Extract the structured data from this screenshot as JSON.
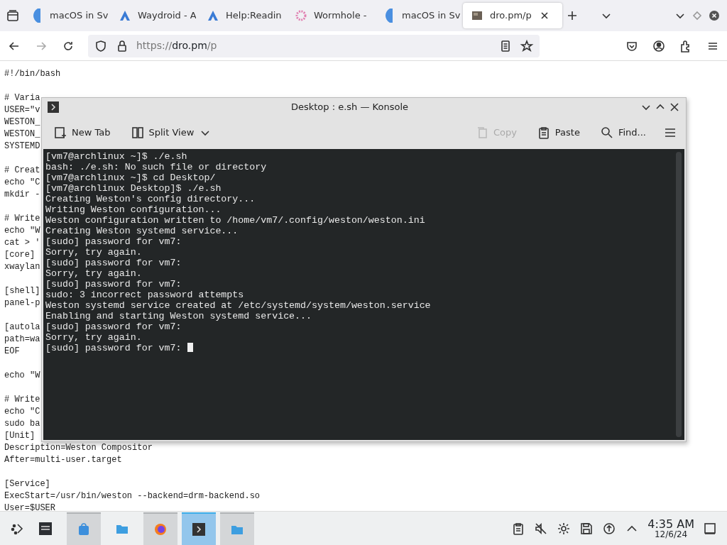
{
  "browser": {
    "tabs": [
      {
        "title": "macOS in Sv",
        "selected": false
      },
      {
        "title": "Waydroid - A",
        "selected": false
      },
      {
        "title": "Help:Readin",
        "selected": false
      },
      {
        "title": "Wormhole -",
        "selected": false
      },
      {
        "title": "macOS in Sv",
        "selected": false
      },
      {
        "title": "dro.pm/p",
        "selected": true
      }
    ],
    "url": {
      "scheme": "https://",
      "host": "dro.pm",
      "path": "/p"
    }
  },
  "page": {
    "blocks": [
      [
        "#!/bin/bash"
      ],
      [
        "# Varia",
        "USER=\"v",
        "WESTON_",
        "WESTON_",
        "SYSTEMD"
      ],
      [
        "# Creat",
        "echo \"C",
        "mkdir -"
      ],
      [
        "# Write",
        "echo \"W",
        "cat > '",
        "[core]",
        "xwaylan"
      ],
      [
        "[shell]",
        "panel-p"
      ],
      [
        "[autola",
        "path=wa",
        "EOF"
      ],
      [
        "echo \"W"
      ],
      [
        "# Write",
        "echo \"C",
        "sudo ba",
        "[Unit]",
        "Description=Weston Compositor",
        "After=multi-user.target"
      ],
      [
        "[Service]",
        "ExecStart=/usr/bin/weston --backend=drm-backend.so",
        "User=$USER"
      ]
    ]
  },
  "konsole": {
    "title": "Desktop : e.sh — Konsole",
    "toolbar": [
      {
        "label": "New Tab",
        "disabled": false
      },
      {
        "label": "Split View",
        "disabled": false
      },
      {
        "label": "Copy",
        "disabled": true
      },
      {
        "label": "Paste",
        "disabled": false
      },
      {
        "label": "Find...",
        "disabled": false
      }
    ],
    "lines": [
      "[vm7@archlinux ~]$ ./e.sh",
      "bash: ./e.sh: No such file or directory",
      "[vm7@archlinux ~]$ cd Desktop/",
      "[vm7@archlinux Desktop]$ ./e.sh",
      "Creating Weston's config directory...",
      "Writing Weston configuration...",
      "Weston configuration written to /home/vm7/.config/weston/weston.ini",
      "Creating Weston systemd service...",
      "[sudo] password for vm7:",
      "Sorry, try again.",
      "[sudo] password for vm7:",
      "Sorry, try again.",
      "[sudo] password for vm7:",
      "sudo: 3 incorrect password attempts",
      "Weston systemd service created at /etc/systemd/system/weston.service",
      "Enabling and starting Weston systemd service...",
      "[sudo] password for vm7:",
      "Sorry, try again.",
      "[sudo] password for vm7:"
    ]
  },
  "taskbar": {
    "tasks": [
      {
        "open": false,
        "selected": false
      },
      {
        "open": true,
        "selected": false
      },
      {
        "open": false,
        "selected": false
      },
      {
        "open": true,
        "selected": false
      },
      {
        "open": true,
        "selected": true
      },
      {
        "open": true,
        "selected": false
      }
    ],
    "time": "4:35 AM",
    "date": "12/6/24"
  }
}
